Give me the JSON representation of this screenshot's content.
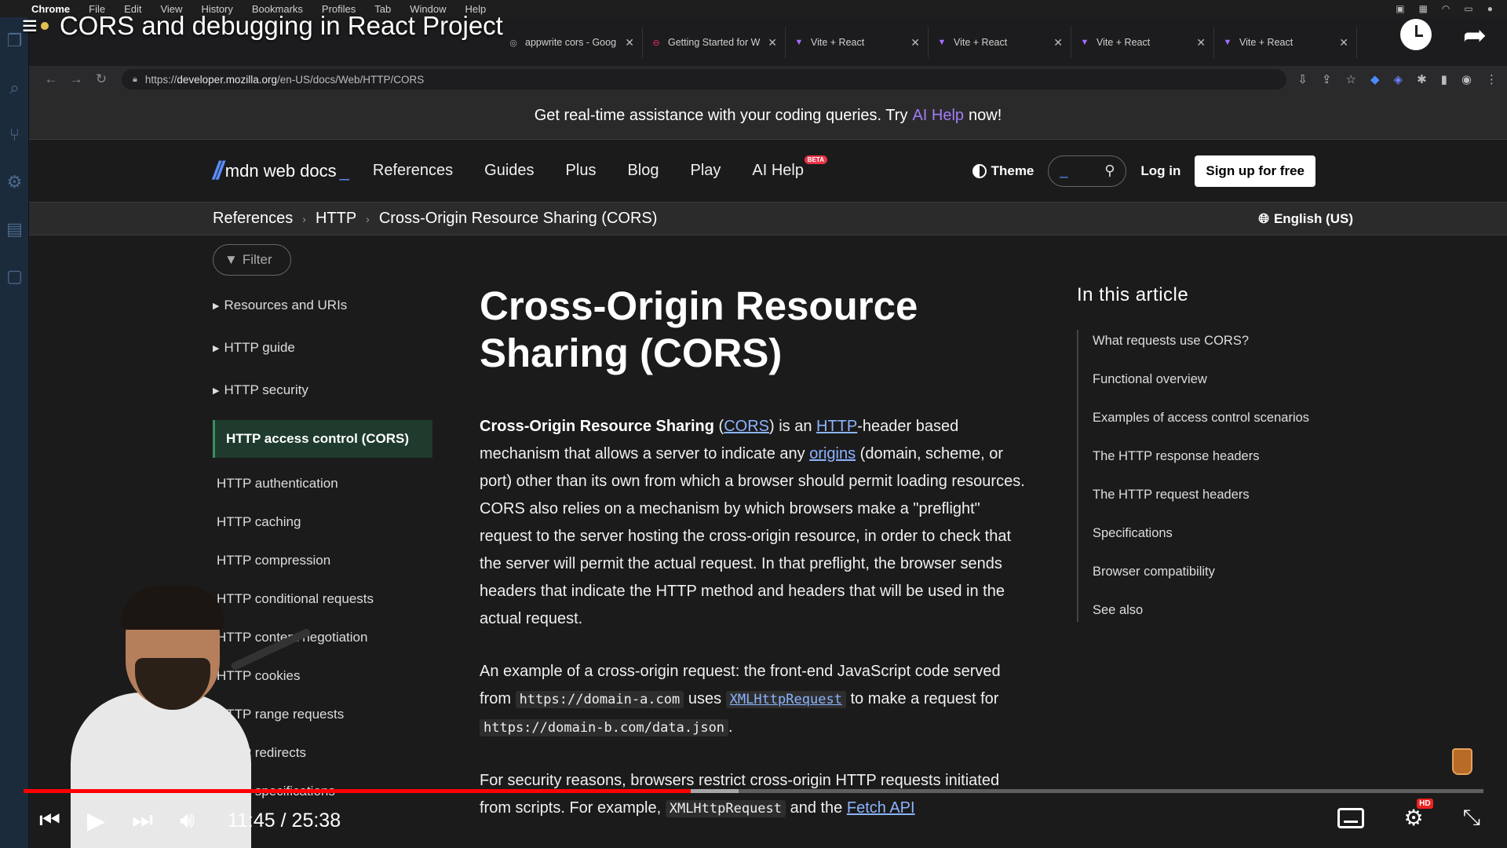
{
  "menubar": {
    "items": [
      "Chrome",
      "File",
      "Edit",
      "View",
      "History",
      "Bookmarks",
      "Profiles",
      "Tab",
      "Window",
      "Help"
    ]
  },
  "video": {
    "title": "CORS and debugging in React Project",
    "time_current": "11:45",
    "time_total": "25:38",
    "progress": 0.457,
    "hd_badge": "HD"
  },
  "browser": {
    "tabs": [
      {
        "title": "appwrite cors - Goog",
        "icon": "google-g-icon"
      },
      {
        "title": "Getting Started for W",
        "icon": "appwrite-icon"
      },
      {
        "title": "Vite + React",
        "icon": "vite-icon"
      },
      {
        "title": "Vite + React",
        "icon": "vite-icon"
      },
      {
        "title": "Vite + React",
        "icon": "vite-icon"
      },
      {
        "title": "Vite + React",
        "icon": "vite-icon"
      }
    ],
    "url_prefix": "https://",
    "url_host": "developer.mozilla.org",
    "url_path": "/en-US/docs/Web/HTTP/CORS"
  },
  "banner": {
    "before": "Get real-time assistance with your coding queries. Try",
    "link": "AI Help",
    "after": "now!"
  },
  "header": {
    "logo": "mdn web docs",
    "nav": [
      "References",
      "Guides",
      "Plus",
      "Blog",
      "Play",
      "AI Help"
    ],
    "beta": "BETA",
    "theme": "Theme",
    "login": "Log in",
    "signup": "Sign up for free"
  },
  "breadcrumb": [
    "References",
    "HTTP",
    "Cross-Origin Resource Sharing (CORS)"
  ],
  "language": "English (US)",
  "sidebar": {
    "filter": "Filter",
    "groups": [
      "Resources and URIs",
      "HTTP guide",
      "HTTP security"
    ],
    "active": "HTTP access control (CORS)",
    "items": [
      "HTTP authentication",
      "HTTP caching",
      "HTTP compression",
      "HTTP conditional requests",
      "HTTP content negotiation",
      "HTTP cookies",
      "HTTP range requests",
      "HTTP redirects",
      "HTTP specifications"
    ]
  },
  "article": {
    "title_line1": "Cross-Origin Resource",
    "title_line2": "Sharing (CORS)",
    "p1": {
      "b": "Cross-Origin Resource Sharing",
      "t1": " (",
      "link_cors": "CORS",
      "t2": ") is an ",
      "link_http": "HTTP",
      "t3": "-header based mechanism that allows a server to indicate any ",
      "link_origins": "origins",
      "t4": " (domain, scheme, or port) other than its own from which a browser should permit loading resources. CORS also relies on a mechanism by which browsers make a \"preflight\" request to the server hosting the cross-origin resource, in order to check that the server will permit the actual request. In that preflight, the browser sends headers that indicate the HTTP method and headers that will be used in the actual request."
    },
    "p2": {
      "t1": "An example of a cross-origin request: the front-end JavaScript code served from ",
      "code1": "https://domain-a.com",
      "t2": " uses ",
      "code2": "XMLHttpRequest",
      "t3": " to make a request for ",
      "code3": "https://domain-b.com/data.json",
      "t4": "."
    },
    "p3": {
      "t1": "For security reasons, browsers restrict cross-origin HTTP requests initiated from scripts. For example, ",
      "code1": "XMLHttpRequest",
      "t2": " and the ",
      "link": "Fetch API"
    }
  },
  "toc": {
    "title": "In this article",
    "items": [
      "What requests use CORS?",
      "Functional overview",
      "Examples of access control scenarios",
      "The HTTP response headers",
      "The HTTP request headers",
      "Specifications",
      "Browser compatibility",
      "See also"
    ]
  }
}
